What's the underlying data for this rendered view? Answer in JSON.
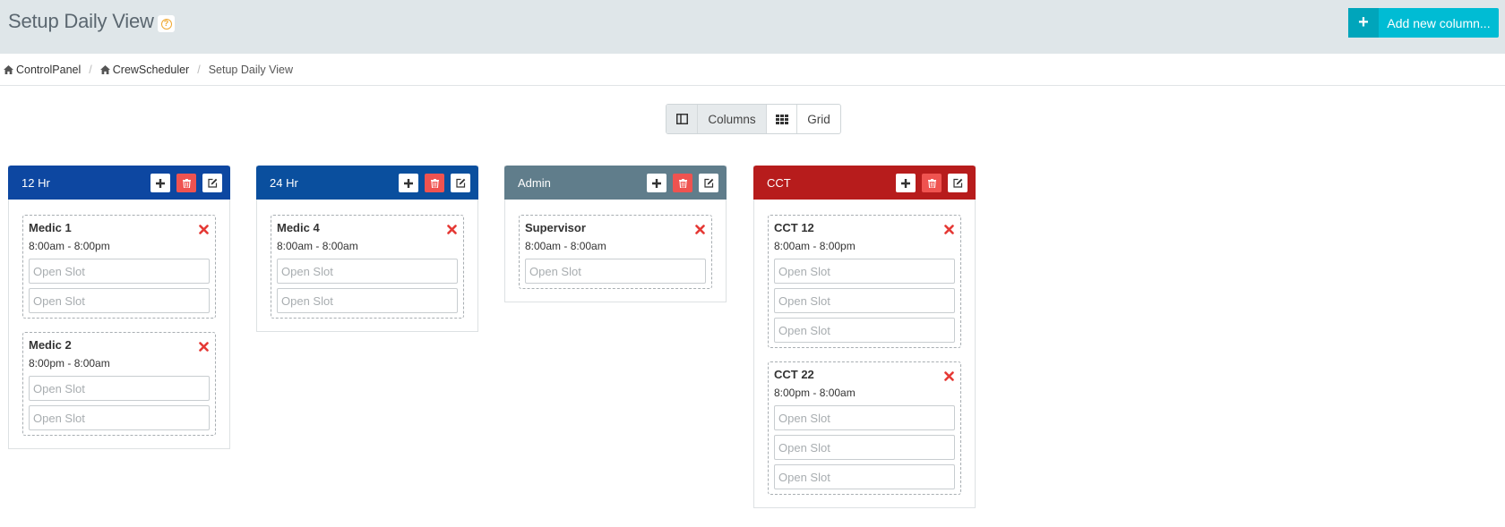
{
  "header": {
    "title": "Setup Daily View",
    "help_icon": "question-circle-icon",
    "add_button_label": "Add new column..."
  },
  "breadcrumb": {
    "items": [
      {
        "label": "ControlPanel",
        "icon": "home-icon"
      },
      {
        "label": "CrewScheduler",
        "icon": "home-icon"
      },
      {
        "label": "Setup Daily View"
      }
    ],
    "separator": "/"
  },
  "view_toggle": {
    "columns_label": "Columns",
    "grid_label": "Grid",
    "active": "Columns"
  },
  "colors": {
    "topbar": "#dfe6e9",
    "accent": "#00bcd4",
    "danger": "#ef5350"
  },
  "columns": [
    {
      "name": "12 Hr",
      "color": "#0d47a1",
      "shifts": [
        {
          "name": "Medic 1",
          "time": "8:00am - 8:00pm",
          "slots": [
            "Open Slot",
            "Open Slot"
          ]
        },
        {
          "name": "Medic 2",
          "time": "8:00pm - 8:00am",
          "slots": [
            "Open Slot",
            "Open Slot"
          ]
        }
      ]
    },
    {
      "name": "24 Hr",
      "color": "#0a4f9e",
      "shifts": [
        {
          "name": "Medic 4",
          "time": "8:00am - 8:00am",
          "slots": [
            "Open Slot",
            "Open Slot"
          ]
        }
      ]
    },
    {
      "name": "Admin",
      "color": "#607d8b",
      "shifts": [
        {
          "name": "Supervisor",
          "time": "8:00am - 8:00am",
          "slots": [
            "Open Slot"
          ]
        }
      ]
    },
    {
      "name": "CCT",
      "color": "#b71c1c",
      "shifts": [
        {
          "name": "CCT 12",
          "time": "8:00am - 8:00pm",
          "slots": [
            "Open Slot",
            "Open Slot",
            "Open Slot"
          ]
        },
        {
          "name": "CCT 22",
          "time": "8:00pm - 8:00am",
          "slots": [
            "Open Slot",
            "Open Slot",
            "Open Slot"
          ]
        }
      ]
    }
  ]
}
